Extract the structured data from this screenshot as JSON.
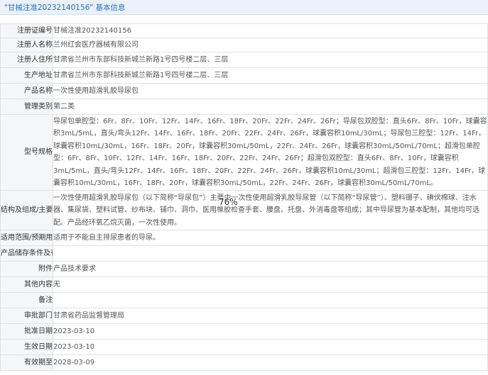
{
  "header": {
    "title": "\"甘械注准20232140156\" 基本信息"
  },
  "rows": [
    {
      "label": "注册证编号",
      "value": "甘械注准20232140156"
    },
    {
      "label": "注册人名称",
      "value": "兰州红会医疗器械有限公司"
    },
    {
      "label": "注册人住所",
      "value": "甘肃省兰州市东部科技新城兰新路1号四号楼二层、三层"
    },
    {
      "label": "生产地址",
      "value": "甘肃省兰州市东部科技新城兰新路1号四号楼二层、三层"
    },
    {
      "label": "产品名称",
      "value": "一次性使用超滑乳胶导尿包"
    },
    {
      "label": "管理类别",
      "value": "第二类"
    },
    {
      "label": "型号规格",
      "value": "导尿包单腔型：6Fr、8Fr、10Fr、12Fr、14Fr、16Fr、18Fr、20Fr、22Fr、24Fr、26Fr；导尿包双腔型：直头6Fr、8Fr、10Fr，球囊容积3mL/5mL，直头/弯头12Fr、14Fr、16Fr、18Fr、20Fr、22Fr、24Fr、26Fr，球囊容积10mL/30mL；导尿包三腔型：12Fr、14Fr，球囊容积10mL/30mL，16Fr、18Fr、20Fr，球囊容积30mL/50mL，22Fr、24Fr、26Fr，球囊容积30mL/50mL/70mL；超滑包单腔型：6Fr、8Fr、10Fr、12Fr、14Fr、16Fr、18Fr、20Fr、22Fr、24Fr、26Fr；超滑包双腔型：直头6Fr、8Fr、10Fr，球囊容积3mL/5mL，直头/弯头12Fr、14Fr、16Fr、18Fr、20Fr、22Fr、24Fr、26Fr，球囊容积10mL/30mL；超滑包三腔型：12Fr、14Fr，球囊容积10mL/30mL，16Fr、18Fr、20Fr，球囊容积30mL/50mL，22Fr、24Fr、26Fr，球囊容积30mL/50mL/70mL。"
    },
    {
      "label": "结构及组成/主要组成成分",
      "value": "一次性使用超滑乳胶导尿包（以下简称“导尿包”）主要由一次性使用超滑乳胶导尿管（以下简称“导尿管”）、塑料镊子、碘伏棉球、注水器、集尿袋、塑料试管、纱布块、铺巾、洞巾、医用橡胶检查手套、腰盘、托盘、外消毒盘等组成；其中导尿管为基本配制，其他均可选配。产品经环氧乙烷灭菌，一次性使用。"
    },
    {
      "label": "适用范围/预期用途",
      "value": "适用于不能自主排尿患者的导尿。"
    },
    {
      "label": "产品储存条件及有效期",
      "value": ""
    },
    {
      "label": "附件",
      "value": "产品技术要求"
    },
    {
      "label": "其他内容",
      "value": "无"
    },
    {
      "label": "备注",
      "value": ""
    },
    {
      "label": "审批部门",
      "value": "甘肃省药品监督管理局"
    },
    {
      "label": "批准日期",
      "value": "2023-03-10"
    },
    {
      "label": "生效日期",
      "value": "2023-03-10"
    },
    {
      "label": "有效期至",
      "value": "2028-03-09"
    }
  ],
  "zoom": "76%"
}
